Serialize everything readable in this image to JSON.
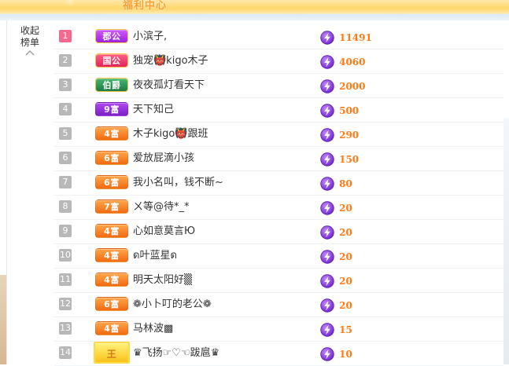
{
  "banner": {
    "text": "福利中心"
  },
  "panel": {
    "collapse_label": "收起榜单"
  },
  "colors": {
    "rank_default": "#b8b8b8",
    "rank_first": "#f7688e",
    "score": "#ff7a13",
    "bolt": "#8a3fe0"
  },
  "leaderboard": [
    {
      "rank": "1",
      "badge": "郡公",
      "badge_style": "duke",
      "name": "小滨子,",
      "score": "11491"
    },
    {
      "rank": "2",
      "badge": "国公",
      "badge_style": "guogong",
      "name": "独宠👹kigo木子",
      "score": "4060"
    },
    {
      "rank": "3",
      "badge": "伯爵",
      "badge_style": "earl",
      "name": "夜夜孤灯看天下",
      "score": "2000"
    },
    {
      "rank": "4",
      "badge": "9富",
      "badge_style": "rich9",
      "name": "天下知己",
      "score": "500"
    },
    {
      "rank": "5",
      "badge": "4富",
      "badge_style": "rich",
      "name": "木子kigo👹跟班",
      "score": "290"
    },
    {
      "rank": "6",
      "badge": "6富",
      "badge_style": "rich",
      "name": "爱放屁滴小孩",
      "score": "150"
    },
    {
      "rank": "7",
      "badge": "6富",
      "badge_style": "rich",
      "name": "我小名叫，钱不断~",
      "score": "80"
    },
    {
      "rank": "8",
      "badge": "7富",
      "badge_style": "rich",
      "name": "ㄨ等@待*_*",
      "score": "20"
    },
    {
      "rank": "9",
      "badge": "4富",
      "badge_style": "rich",
      "name": "心如意莫言Ю",
      "score": "20"
    },
    {
      "rank": "10",
      "badge": "4富",
      "badge_style": "rich",
      "name": "ด叶蓝星ด",
      "score": "20"
    },
    {
      "rank": "11",
      "badge": "4富",
      "badge_style": "rich",
      "name": "明天太阳好▒",
      "score": "20"
    },
    {
      "rank": "12",
      "badge": "6富",
      "badge_style": "rich",
      "name": "❁小卜叮的老公❁",
      "score": "20"
    },
    {
      "rank": "13",
      "badge": "4富",
      "badge_style": "rich",
      "name": "马林波▩",
      "score": "15"
    },
    {
      "rank": "14",
      "badge": "王",
      "badge_style": "king",
      "name": "♛飞扬☞♡☜跋扈♛",
      "score": "10"
    }
  ]
}
